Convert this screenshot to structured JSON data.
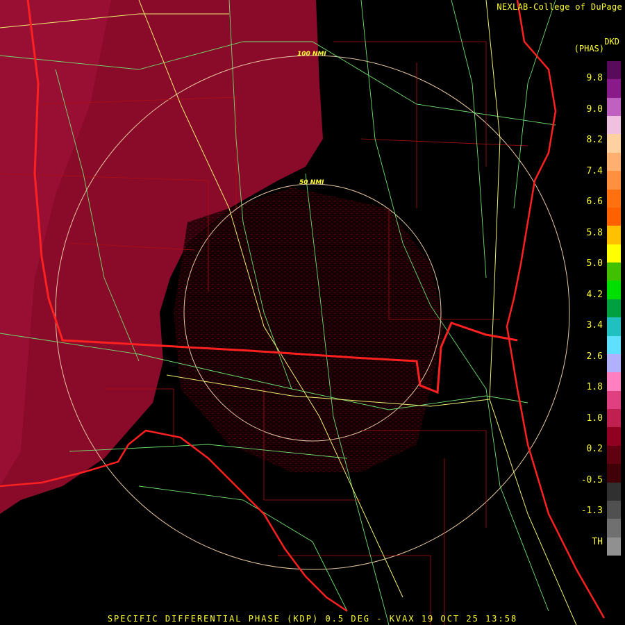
{
  "credit": "NEXLAB-College of DuPage",
  "units": {
    "top": "DKD",
    "bottom": "(PHAS)"
  },
  "footer": "SPECIFIC DIFFERENTIAL PHASE (KDP) 0.5 DEG - KVAX 19 OCT 25 13:58",
  "ring_labels": {
    "outer": "100 NMI",
    "inner": "50 NMI"
  },
  "legend": {
    "ticks": [
      "9.8",
      "9.0",
      "8.2",
      "7.4",
      "6.6",
      "5.8",
      "5.0",
      "4.2",
      "3.4",
      "2.6",
      "1.8",
      "1.0",
      "0.2",
      "-0.5",
      "-1.3",
      "TH"
    ],
    "colors": [
      "#5a0a5a",
      "#8a1a8a",
      "#c060c0",
      "#f0c0e0",
      "#ffd0a0",
      "#ffb070",
      "#ff9040",
      "#ff7010",
      "#ff6000",
      "#ffc000",
      "#ffff00",
      "#40c000",
      "#00e000",
      "#00a040",
      "#20c0c0",
      "#60e0ff",
      "#b0b0ff",
      "#ff80c0",
      "#e04080",
      "#c02050",
      "#900020",
      "#600010",
      "#400008",
      "#303030",
      "#505050",
      "#707070",
      "#909090"
    ]
  }
}
